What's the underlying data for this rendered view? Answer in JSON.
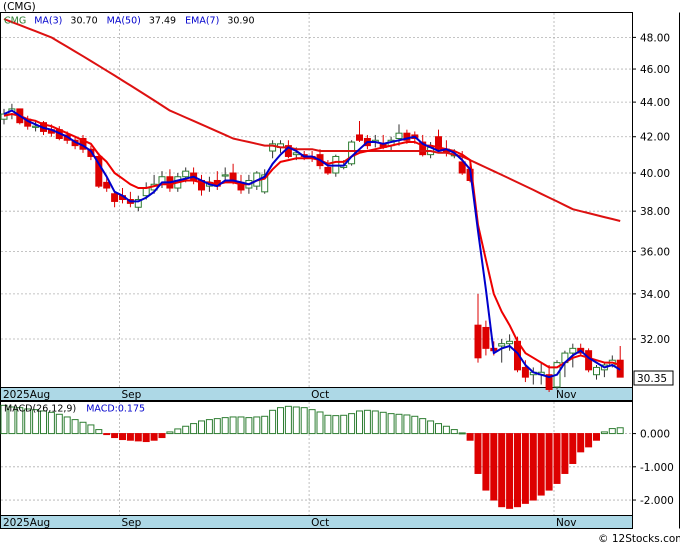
{
  "title": "(CMG)",
  "legend": {
    "symbol": "CMG",
    "ma3_label": "MA(3)",
    "ma3_value": "30.70",
    "ma50_label": "MA(50)",
    "ma50_value": "37.49",
    "ema7_label": "EMA(7)",
    "ema7_value": "30.90"
  },
  "last_price": "30.35",
  "macd_legend": {
    "label": "MACD(26,12,9)",
    "value_label": "MACD:0.175"
  },
  "axis": {
    "price_ticks": [
      "32.00",
      "34.00",
      "36.00",
      "38.00",
      "40.00",
      "42.00",
      "44.00",
      "46.00",
      "48.00"
    ],
    "macd_ticks": [
      "0.000",
      "-1.000",
      "-2.000"
    ],
    "month_labels": [
      "2025Aug",
      "Sep",
      "Oct",
      "Nov"
    ]
  },
  "watermark": "© 12Stocks.com",
  "colors": {
    "up": "#2e7d32",
    "down": "#dd0000",
    "ma3": "#0000cc",
    "ma50": "#dd1111",
    "ema7": "#ee0000",
    "axis_band": "#add8e6",
    "macd_bar": "#2e7d32",
    "macd_neg": "#dd0000"
  },
  "chart_data": [
    {
      "type": "candlestick",
      "ylabel": "",
      "ylim": [
        30.0,
        49.6
      ],
      "scale": "log",
      "x_start_label": "2025Aug",
      "candles": [
        [
          43.0,
          43.6,
          42.7,
          43.3
        ],
        [
          43.3,
          43.9,
          43.0,
          43.6
        ],
        [
          43.6,
          43.6,
          42.7,
          42.8
        ],
        [
          43.0,
          43.2,
          42.4,
          42.6
        ],
        [
          42.6,
          42.9,
          42.3,
          42.6
        ],
        [
          42.8,
          42.9,
          42.1,
          42.3
        ],
        [
          42.4,
          42.7,
          42.0,
          42.2
        ],
        [
          42.4,
          42.6,
          41.8,
          41.9
        ],
        [
          42.1,
          42.3,
          41.6,
          41.8
        ],
        [
          41.8,
          42.0,
          41.3,
          41.5
        ],
        [
          41.9,
          42.1,
          41.1,
          41.3
        ],
        [
          41.3,
          41.5,
          40.7,
          40.9
        ],
        [
          40.9,
          41.1,
          39.2,
          39.3
        ],
        [
          39.5,
          39.8,
          39.0,
          39.2
        ],
        [
          38.9,
          39.0,
          38.2,
          38.5
        ],
        [
          38.8,
          39.2,
          38.4,
          38.6
        ],
        [
          38.6,
          39.0,
          38.2,
          38.4
        ],
        [
          38.2,
          38.8,
          38.0,
          38.6
        ],
        [
          38.8,
          39.5,
          38.6,
          39.2
        ],
        [
          39.1,
          39.9,
          38.9,
          39.4
        ],
        [
          39.4,
          40.1,
          39.2,
          39.8
        ],
        [
          39.8,
          40.2,
          39.0,
          39.2
        ],
        [
          39.2,
          40.0,
          39.0,
          39.8
        ],
        [
          39.8,
          40.3,
          39.5,
          40.1
        ],
        [
          40.0,
          40.3,
          39.4,
          39.6
        ],
        [
          39.6,
          39.9,
          38.8,
          39.1
        ],
        [
          39.3,
          39.8,
          39.0,
          39.5
        ],
        [
          39.6,
          40.1,
          39.1,
          39.3
        ],
        [
          39.9,
          40.3,
          39.6,
          39.9
        ],
        [
          40.0,
          40.5,
          39.4,
          39.5
        ],
        [
          39.5,
          39.9,
          38.9,
          39.1
        ],
        [
          39.2,
          39.9,
          38.9,
          39.6
        ],
        [
          39.3,
          40.1,
          39.1,
          40.0
        ],
        [
          39.0,
          40.2,
          38.9,
          39.9
        ],
        [
          41.2,
          41.8,
          40.8,
          41.6
        ],
        [
          41.4,
          41.8,
          41.1,
          41.6
        ],
        [
          41.5,
          41.8,
          40.8,
          40.9
        ],
        [
          41.0,
          41.4,
          40.7,
          41.1
        ],
        [
          41.0,
          41.2,
          40.7,
          40.9
        ],
        [
          40.9,
          41.2,
          40.6,
          40.8
        ],
        [
          41.0,
          41.3,
          40.2,
          40.4
        ],
        [
          40.3,
          40.7,
          39.9,
          40.0
        ],
        [
          40.0,
          41.0,
          39.8,
          40.9
        ],
        [
          40.3,
          40.7,
          40.2,
          40.4
        ],
        [
          40.5,
          41.8,
          40.4,
          41.7
        ],
        [
          42.1,
          42.9,
          41.7,
          41.8
        ],
        [
          41.9,
          42.1,
          41.3,
          41.5
        ],
        [
          41.7,
          42.1,
          41.4,
          41.8
        ],
        [
          41.6,
          42.1,
          41.3,
          41.4
        ],
        [
          41.5,
          42.0,
          41.2,
          41.8
        ],
        [
          41.9,
          42.7,
          41.5,
          42.2
        ],
        [
          42.2,
          42.4,
          41.6,
          41.8
        ],
        [
          42.1,
          42.3,
          41.6,
          41.9
        ],
        [
          41.7,
          42.1,
          40.9,
          41.0
        ],
        [
          41.0,
          41.7,
          40.8,
          41.4
        ],
        [
          42.0,
          42.4,
          41.2,
          41.3
        ],
        [
          41.3,
          41.8,
          40.9,
          41.1
        ],
        [
          41.0,
          41.3,
          40.8,
          41.0
        ],
        [
          40.6,
          41.2,
          39.9,
          40.0
        ],
        [
          40.2,
          40.5,
          39.5,
          39.6
        ],
        [
          32.6,
          34.0,
          31.0,
          31.2
        ],
        [
          32.5,
          32.8,
          31.3,
          31.6
        ],
        [
          31.6,
          31.9,
          31.3,
          31.5
        ],
        [
          31.7,
          32.0,
          31.0,
          31.8
        ],
        [
          31.8,
          32.2,
          31.5,
          31.9
        ],
        [
          31.9,
          32.1,
          30.6,
          30.7
        ],
        [
          30.8,
          31.1,
          30.2,
          30.4
        ],
        [
          30.5,
          30.8,
          30.1,
          30.6
        ],
        [
          30.5,
          31.0,
          30.1,
          30.6
        ],
        [
          30.5,
          30.9,
          29.8,
          29.9
        ],
        [
          30.0,
          31.1,
          29.9,
          31.0
        ],
        [
          31.0,
          31.5,
          30.4,
          31.4
        ],
        [
          31.4,
          31.8,
          30.8,
          31.6
        ],
        [
          31.6,
          31.8,
          31.3,
          31.4
        ],
        [
          31.5,
          31.6,
          30.6,
          30.7
        ],
        [
          30.5,
          30.9,
          30.3,
          30.8
        ],
        [
          30.7,
          31.0,
          30.4,
          30.9
        ],
        [
          30.9,
          31.3,
          30.8,
          31.1
        ],
        [
          31.1,
          31.7,
          30.4,
          30.4
        ]
      ],
      "ma3": [
        43.3,
        43.5,
        43.2,
        42.9,
        42.7,
        42.5,
        42.4,
        42.2,
        42.0,
        41.7,
        41.5,
        41.2,
        40.5,
        39.8,
        39.0,
        38.8,
        38.5,
        38.5,
        38.7,
        39.0,
        39.5,
        39.5,
        39.6,
        39.7,
        39.8,
        39.6,
        39.4,
        39.3,
        39.6,
        39.6,
        39.5,
        39.4,
        39.6,
        39.8,
        40.5,
        41.0,
        41.4,
        41.2,
        40.9,
        40.9,
        40.7,
        40.4,
        40.4,
        40.4,
        40.9,
        41.3,
        41.7,
        41.7,
        41.6,
        41.7,
        41.8,
        41.9,
        42.0,
        41.6,
        41.4,
        41.2,
        41.3,
        41.1,
        40.7,
        40.2,
        37.0,
        34.2,
        31.4,
        31.6,
        31.7,
        31.4,
        30.9,
        30.6,
        30.5,
        30.4,
        30.5,
        31.0,
        31.3,
        31.5,
        31.2,
        31.0,
        30.8,
        30.9,
        30.7
      ],
      "ema7": [
        43.2,
        43.3,
        43.2,
        43.0,
        42.9,
        42.7,
        42.6,
        42.4,
        42.2,
        42.0,
        41.8,
        41.6,
        41.0,
        40.6,
        40.0,
        39.7,
        39.4,
        39.2,
        39.2,
        39.3,
        39.4,
        39.4,
        39.5,
        39.6,
        39.6,
        39.5,
        39.5,
        39.4,
        39.5,
        39.5,
        39.4,
        39.4,
        39.6,
        39.7,
        40.2,
        40.6,
        40.7,
        40.8,
        40.8,
        40.8,
        40.7,
        40.5,
        40.6,
        40.6,
        40.9,
        41.1,
        41.2,
        41.3,
        41.4,
        41.5,
        41.6,
        41.7,
        41.7,
        41.5,
        41.5,
        41.4,
        41.3,
        41.2,
        41.0,
        40.7,
        37.3,
        35.6,
        34.0,
        33.2,
        32.6,
        31.9,
        31.4,
        31.2,
        31.0,
        30.8,
        30.8,
        31.0,
        31.2,
        31.3,
        31.2,
        31.1,
        31.0,
        31.0,
        30.9
      ],
      "ma50": [
        49.2,
        49.0,
        48.8,
        48.6,
        48.4,
        48.2,
        48.0,
        47.7,
        47.4,
        47.1,
        46.8,
        46.5,
        46.2,
        45.9,
        45.6,
        45.3,
        45.0,
        44.7,
        44.4,
        44.1,
        43.8,
        43.5,
        43.3,
        43.1,
        42.9,
        42.7,
        42.5,
        42.3,
        42.1,
        41.9,
        41.8,
        41.7,
        41.6,
        41.5,
        41.5,
        41.4,
        41.4,
        41.3,
        41.3,
        41.3,
        41.2,
        41.2,
        41.2,
        41.2,
        41.2,
        41.2,
        41.2,
        41.2,
        41.2,
        41.2,
        41.2,
        41.2,
        41.2,
        41.2,
        41.2,
        41.1,
        41.1,
        41.0,
        40.9,
        40.7,
        40.5,
        40.3,
        40.1,
        39.9,
        39.7,
        39.5,
        39.3,
        39.1,
        38.9,
        38.7,
        38.5,
        38.3,
        38.1,
        38.0,
        37.9,
        37.8,
        37.7,
        37.6,
        37.5
      ]
    },
    {
      "type": "bar",
      "title": "",
      "ylim": [
        -2.45,
        0.95
      ],
      "values": [
        0.85,
        0.8,
        0.78,
        0.74,
        0.72,
        0.68,
        0.64,
        0.58,
        0.5,
        0.42,
        0.34,
        0.26,
        0.12,
        -0.02,
        -0.12,
        -0.18,
        -0.2,
        -0.22,
        -0.24,
        -0.2,
        -0.12,
        0.05,
        0.14,
        0.22,
        0.3,
        0.38,
        0.42,
        0.45,
        0.48,
        0.5,
        0.5,
        0.48,
        0.5,
        0.52,
        0.7,
        0.78,
        0.82,
        0.8,
        0.78,
        0.72,
        0.65,
        0.55,
        0.54,
        0.55,
        0.6,
        0.68,
        0.7,
        0.68,
        0.64,
        0.6,
        0.58,
        0.56,
        0.52,
        0.45,
        0.38,
        0.3,
        0.22,
        0.12,
        0.02,
        -0.2,
        -1.2,
        -1.7,
        -2.0,
        -2.2,
        -2.25,
        -2.2,
        -2.1,
        -2.0,
        -1.85,
        -1.7,
        -1.5,
        -1.2,
        -0.9,
        -0.55,
        -0.4,
        -0.2,
        0.05,
        0.15,
        0.175
      ]
    }
  ]
}
